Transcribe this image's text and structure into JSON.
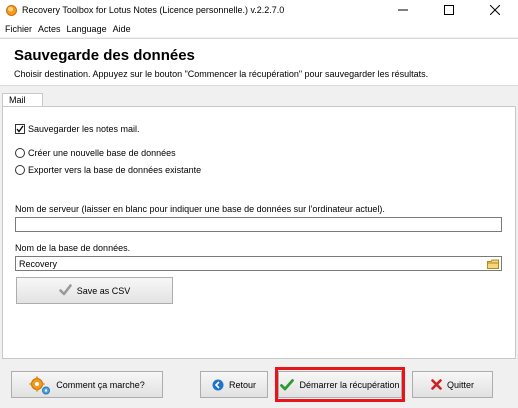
{
  "window": {
    "title": "Recovery Toolbox for Lotus Notes (Licence personnelle.) v.2.2.7.0",
    "controls": {
      "minimize": "minimize-icon",
      "maximize": "maximize-icon",
      "close": "close-icon"
    }
  },
  "menu": {
    "items": [
      "Fichier",
      "Actes",
      "Language",
      "Aide"
    ]
  },
  "header": {
    "title": "Sauvegarde des données",
    "subtitle": "Choisir destination. Appuyez sur le bouton \"Commencer la récupération\" pour sauvegarder les résultats."
  },
  "tabs": [
    "Mail"
  ],
  "form": {
    "save_mail_label": "Sauvegarder les notes mail.",
    "save_mail_checked": true,
    "radio_new_db_label": "Créer une nouvelle base de données",
    "radio_existing_db_label": "Exporter vers la base de données existante",
    "server_label": "Nom de serveur (laisser en blanc pour indiquer une base de données sur l'ordinateur actuel).",
    "server_value": "",
    "db_name_label": "Nom de la base de données.",
    "db_name_value": "Recovery",
    "csv_button_label": "Save as CSV"
  },
  "footer": {
    "how_it_works_label": "Comment ça marche?",
    "back_label": "Retour",
    "start_label": "Démarrer la récupération",
    "quit_label": "Quitter"
  },
  "colors": {
    "highlight": "#e8141a",
    "accent_green": "#2e9b2e",
    "accent_red": "#cc2222",
    "accent_blue": "#1f73c9",
    "gear_orange": "#f39a1d"
  }
}
